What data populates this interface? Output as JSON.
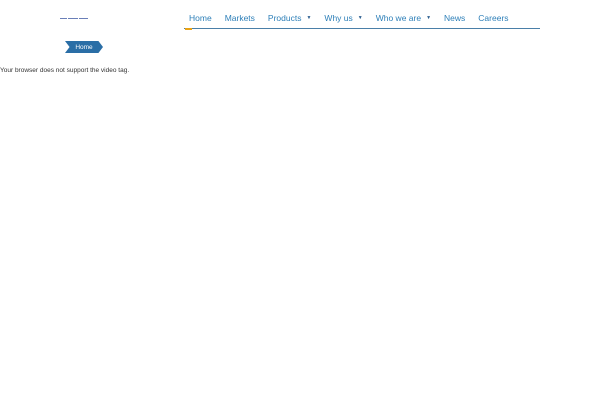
{
  "header": {
    "logo_name": "logo-icon"
  },
  "nav": {
    "items": [
      {
        "label": "Home",
        "active": true,
        "has_dropdown": false
      },
      {
        "label": "Markets",
        "active": false,
        "has_dropdown": false
      },
      {
        "label": "Products",
        "active": false,
        "has_dropdown": true
      },
      {
        "label": "Why us",
        "active": false,
        "has_dropdown": true
      },
      {
        "label": "Who we are",
        "active": false,
        "has_dropdown": true
      },
      {
        "label": "News",
        "active": false,
        "has_dropdown": false
      },
      {
        "label": "Careers",
        "active": false,
        "has_dropdown": false
      }
    ],
    "dropdown_glyph": "▼",
    "accent_color": "#e8a317",
    "link_color": "#2d7fb8"
  },
  "breadcrumb": {
    "label": "Home",
    "color": "#2a6ea6"
  },
  "video": {
    "fallback_text": "Your browser does not support the video tag."
  }
}
